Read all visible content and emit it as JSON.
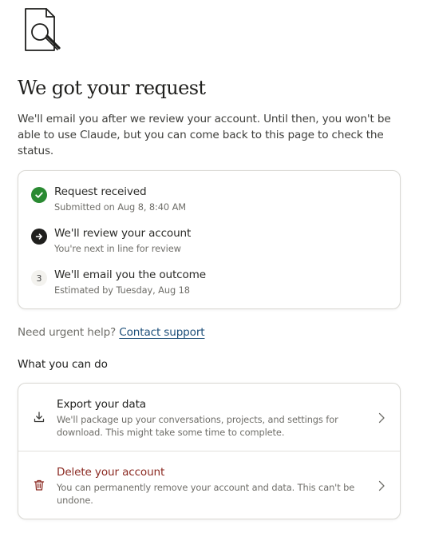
{
  "header": {
    "title": "We got your request",
    "intro": "We'll email you after we review your account. Until then, you won't be able to use Claude, but you can come back to this page to check the status."
  },
  "steps": [
    {
      "label": "Request received",
      "detail": "Submitted on Aug 8, 8:40 AM",
      "state": "done",
      "icon": "check-icon"
    },
    {
      "label": "We'll review your account",
      "detail": "You're next in line for review",
      "state": "current",
      "icon": "arrow-right-icon"
    },
    {
      "label": "We'll email you the outcome",
      "detail": "Estimated by Tuesday, Aug 18",
      "state": "pending",
      "number": "3"
    }
  ],
  "help": {
    "prompt": "Need urgent help?",
    "link_label": "Contact support"
  },
  "actions_section": {
    "title": "What you can do",
    "items": [
      {
        "title": "Export your data",
        "description": "We'll package up your conversations, projects, and settings for download. This might take some time to complete.",
        "icon": "download-icon"
      },
      {
        "title": "Delete your account",
        "description": "You can permanently remove your account and data. This can't be undone.",
        "icon": "trash-icon"
      }
    ]
  },
  "colors": {
    "done": "#2a8a32",
    "current": "#1f1f1d",
    "danger": "#8b2a22",
    "link": "#1d4f7a"
  }
}
